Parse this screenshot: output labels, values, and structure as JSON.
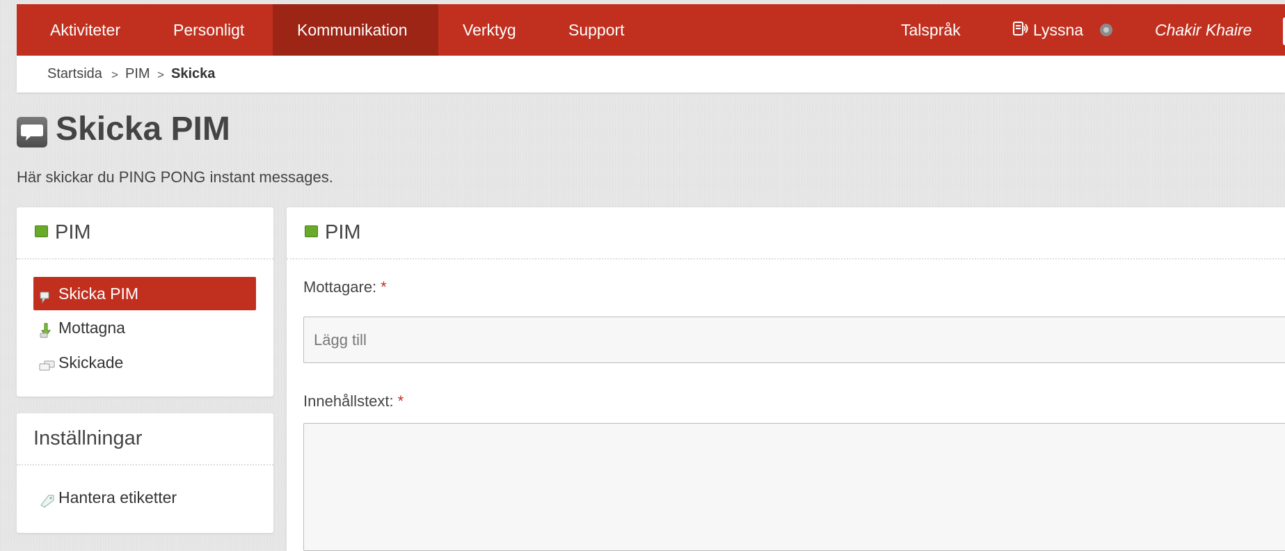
{
  "nav": {
    "items": [
      "Aktiviteter",
      "Personligt",
      "Kommunikation",
      "Verktyg",
      "Support"
    ],
    "active": "Kommunikation",
    "language": "Talspråk",
    "listen": "Lyssna",
    "user": "Chakir Khaire"
  },
  "breadcrumb": {
    "home": "Startsida",
    "section": "PIM",
    "current": "Skicka",
    "separator": ">"
  },
  "page": {
    "title": "Skicka PIM",
    "description": "Här skickar du PING PONG instant messages."
  },
  "sidebar": {
    "pim_title": "PIM",
    "items": [
      {
        "label": "Skicka PIM",
        "icon": "send-message-icon"
      },
      {
        "label": "Mottagna",
        "icon": "inbox-arrow-icon"
      },
      {
        "label": "Skickade",
        "icon": "sent-messages-icon"
      }
    ],
    "settings_title": "Inställningar",
    "settings_items": [
      {
        "label": "Hantera etiketter",
        "icon": "tag-icon"
      }
    ]
  },
  "form": {
    "panel_title": "PIM",
    "recipient_label": "Mottagare:",
    "recipient_placeholder": "Lägg till",
    "content_label": "Innehållstext:",
    "required_marker": "*"
  },
  "colors": {
    "brand": "#c1301f",
    "brand_dark": "#9d2516",
    "accent_green": "#6aaa2a"
  }
}
